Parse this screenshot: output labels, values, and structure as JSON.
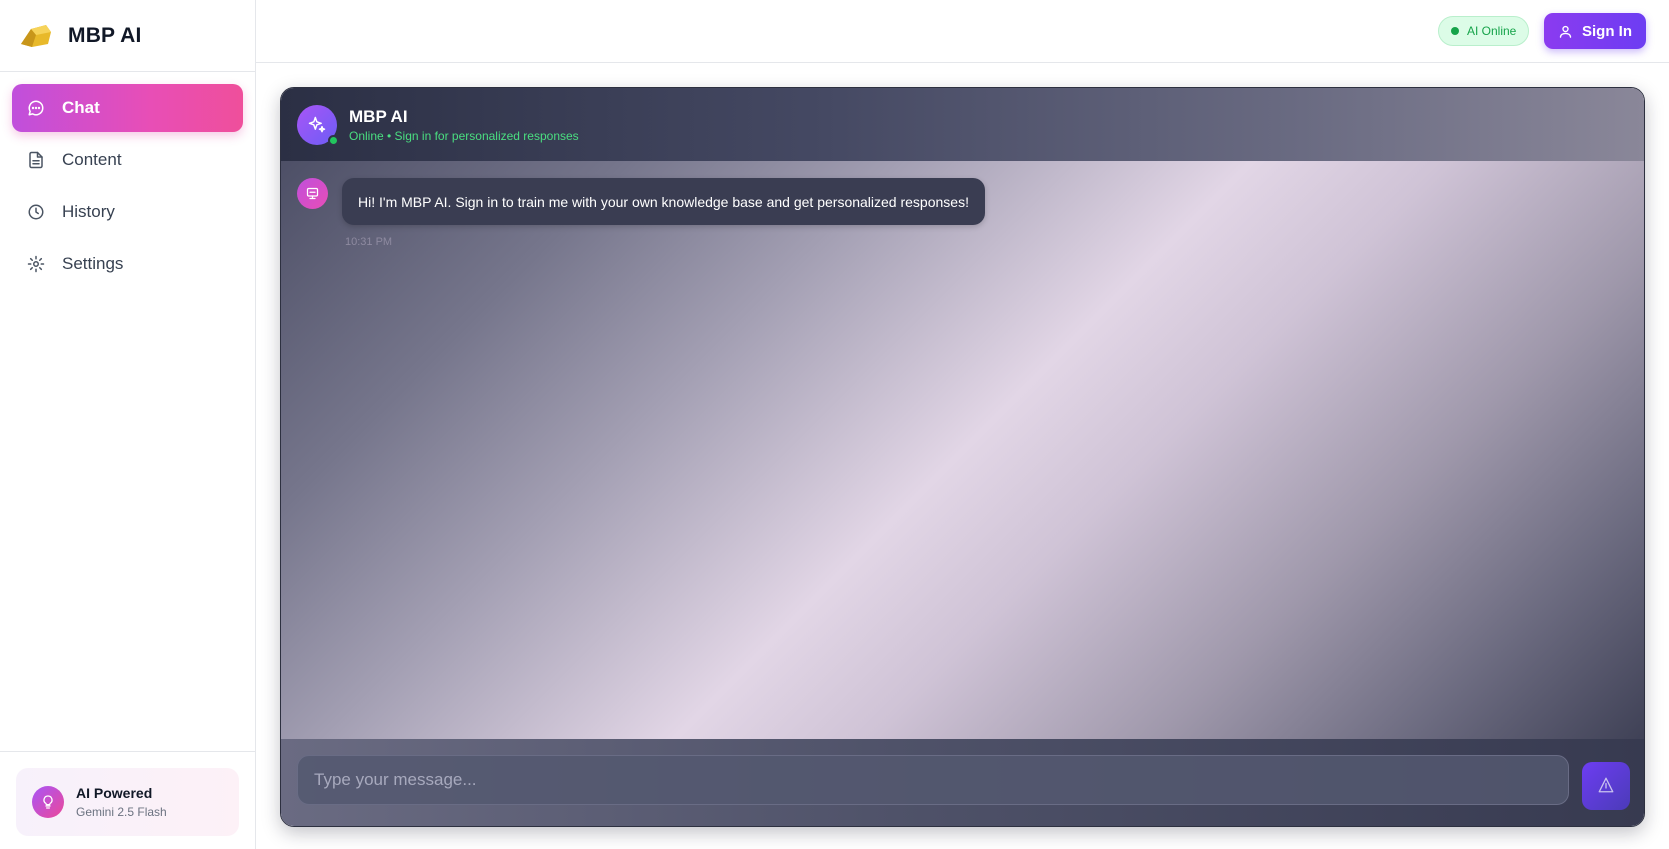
{
  "brand": {
    "name": "MBP AI"
  },
  "nav": {
    "items": [
      {
        "label": "Chat",
        "icon": "chat-bubble-icon",
        "active": true
      },
      {
        "label": "Content",
        "icon": "document-icon",
        "active": false
      },
      {
        "label": "History",
        "icon": "clock-icon",
        "active": false
      },
      {
        "label": "Settings",
        "icon": "gear-icon",
        "active": false
      }
    ]
  },
  "sidebar_footer": {
    "title": "AI Powered",
    "subtitle": "Gemini 2.5 Flash",
    "icon": "lightbulb-icon"
  },
  "topbar": {
    "status_label": "AI Online",
    "signin_label": "Sign In",
    "signin_icon": "user-icon"
  },
  "chat": {
    "title": "MBP AI",
    "subtitle": "Online • Sign in for personalized responses",
    "avatar_icon": "sparkles-icon",
    "messages": [
      {
        "sender": "bot",
        "avatar_icon": "bot-icon",
        "text": "Hi! I'm MBP AI. Sign in to train me with your own knowledge base and get personalized responses!",
        "time": "10:31 PM"
      }
    ],
    "input_placeholder": "Type your message...",
    "input_value": "",
    "send_icon": "send-icon"
  },
  "colors": {
    "accent_gradient_start": "#c04fdc",
    "accent_gradient_end": "#ef4f9b",
    "signin_button": "#7c3cf1",
    "online_green": "#22c55e",
    "chat_dark": "#2b2f44"
  }
}
